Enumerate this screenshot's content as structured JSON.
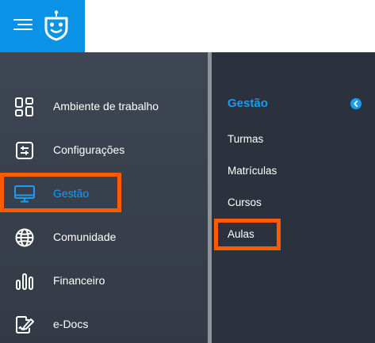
{
  "colors": {
    "brand_blue": "#0a93e6",
    "active_blue": "#1a9cf0",
    "highlight_orange": "#ff5a00",
    "sidebar_bg": "#3a414d",
    "subpanel_bg": "#2c323d"
  },
  "topbar": {
    "menu_icon": "hamburger-icon",
    "logo_icon": "owl-logo-icon"
  },
  "sidebar": {
    "items": [
      {
        "label": "Ambiente de trabalho",
        "icon": "dashboard-grid-icon",
        "active": false
      },
      {
        "label": "Configurações",
        "icon": "settings-sliders-icon",
        "active": false
      },
      {
        "label": "Gestão",
        "icon": "monitor-icon",
        "active": true
      },
      {
        "label": "Comunidade",
        "icon": "globe-icon",
        "active": false
      },
      {
        "label": "Financeiro",
        "icon": "bar-chart-icon",
        "active": false
      },
      {
        "label": "e-Docs",
        "icon": "document-signature-icon",
        "active": false
      }
    ]
  },
  "submenu": {
    "title": "Gestão",
    "collapse_icon": "chevron-left-icon",
    "items": [
      {
        "label": "Turmas"
      },
      {
        "label": "Matrículas"
      },
      {
        "label": "Cursos"
      },
      {
        "label": "Aulas"
      }
    ]
  }
}
